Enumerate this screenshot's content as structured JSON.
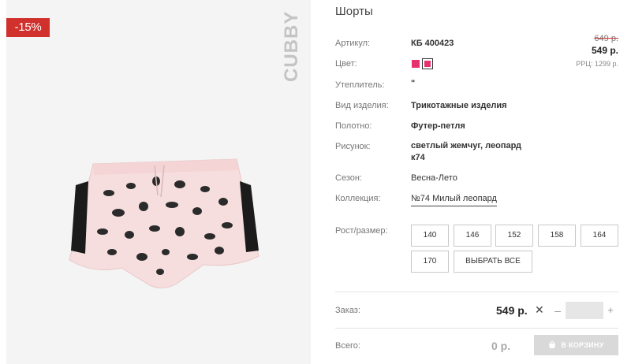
{
  "product": {
    "title": "Шорты",
    "discount_badge": "-15%",
    "brand_logo_text": "CUBBY"
  },
  "specs": {
    "article": {
      "label": "Артикул:",
      "value": "КБ 400423"
    },
    "color": {
      "label": "Цвет:",
      "swatches": [
        "#e5316e",
        "#e5316e"
      ]
    },
    "insulation": {
      "label": "Утеплитель:",
      "value": "\""
    },
    "product_type": {
      "label": "Вид изделия:",
      "value": "Трикотажные изделия"
    },
    "fabric": {
      "label": "Полотно:",
      "value": "Футер-петля"
    },
    "pattern": {
      "label": "Рисунок:",
      "value_line1": "светлый жемчуг, леопард",
      "value_line2": "к74"
    },
    "season": {
      "label": "Сезон:",
      "value": "Весна-Лето"
    },
    "collection": {
      "label": "Коллекция:",
      "value": "№74 Милый леопард"
    }
  },
  "price": {
    "old": "649 р.",
    "new": "549 р.",
    "rrp": "РРЦ: 1299 р."
  },
  "sizes": {
    "label": "Рост/размер:",
    "options": [
      "140",
      "146",
      "152",
      "158",
      "164",
      "170"
    ],
    "select_all": "ВЫБРАТЬ ВСЕ"
  },
  "order": {
    "label": "Заказ:",
    "price": "549 р.",
    "quantity": "",
    "minus": "–",
    "plus": "+",
    "times": "✕"
  },
  "total": {
    "label": "Всего:",
    "value": "0 р.",
    "cart_button": "В КОРЗИНУ"
  },
  "colors": {
    "accent_red": "#d0312d",
    "swatch_pink": "#e5316e",
    "button_disabled": "#d9d9d9"
  }
}
